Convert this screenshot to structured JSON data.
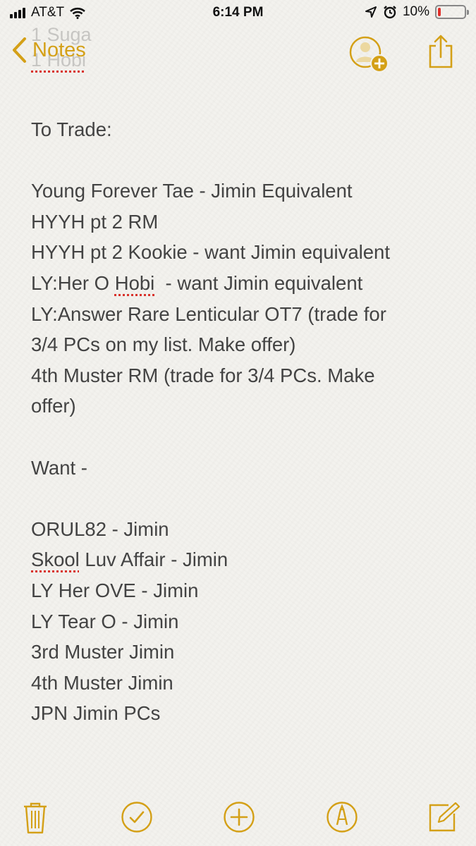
{
  "status_bar": {
    "carrier": "AT&T",
    "time": "6:14 PM",
    "battery_percent": "10%",
    "battery_level": 0.1,
    "icons": [
      "signal-bars-icon",
      "wifi-icon",
      "location-arrow-icon",
      "alarm-clock-icon",
      "battery-icon"
    ]
  },
  "nav": {
    "back_label": "Notes",
    "ghost_lines": [
      "1 Suga",
      "1 Hobi"
    ],
    "accent_color": "#d4a017",
    "icons": [
      "chevron-left-icon",
      "add-person-icon",
      "share-icon"
    ]
  },
  "note": {
    "lines": [
      "To Trade:",
      "",
      "Young Forever Tae - Jimin Equivalent",
      "HYYH pt 2 RM",
      "HYYH pt 2 Kookie - want Jimin equivalent",
      "LY:Her O Hobi  - want Jimin equivalent",
      "LY:Answer Rare Lenticular OT7 (trade for",
      "3/4 PCs on my list. Make offer)",
      "4th Muster RM (trade for 3/4 PCs. Make",
      "offer)",
      "",
      "Want -",
      "",
      "ORUL82 - Jimin",
      "Skool Luv Affair - Jimin",
      "LY Her OVE - Jimin",
      "LY Tear O - Jimin",
      "3rd Muster Jimin",
      "4th Muster Jimin",
      "JPN Jimin PCs"
    ],
    "hobi_prefix": "LY:Her O ",
    "hobi_word": "Hobi",
    "hobi_suffix": "  - want Jimin equivalent",
    "skool_word": "Skool",
    "skool_suffix": " Luv Affair - Jimin"
  },
  "toolbar": {
    "icons": [
      "trash-icon",
      "checklist-icon",
      "add-icon",
      "sketch-icon",
      "compose-icon"
    ]
  }
}
